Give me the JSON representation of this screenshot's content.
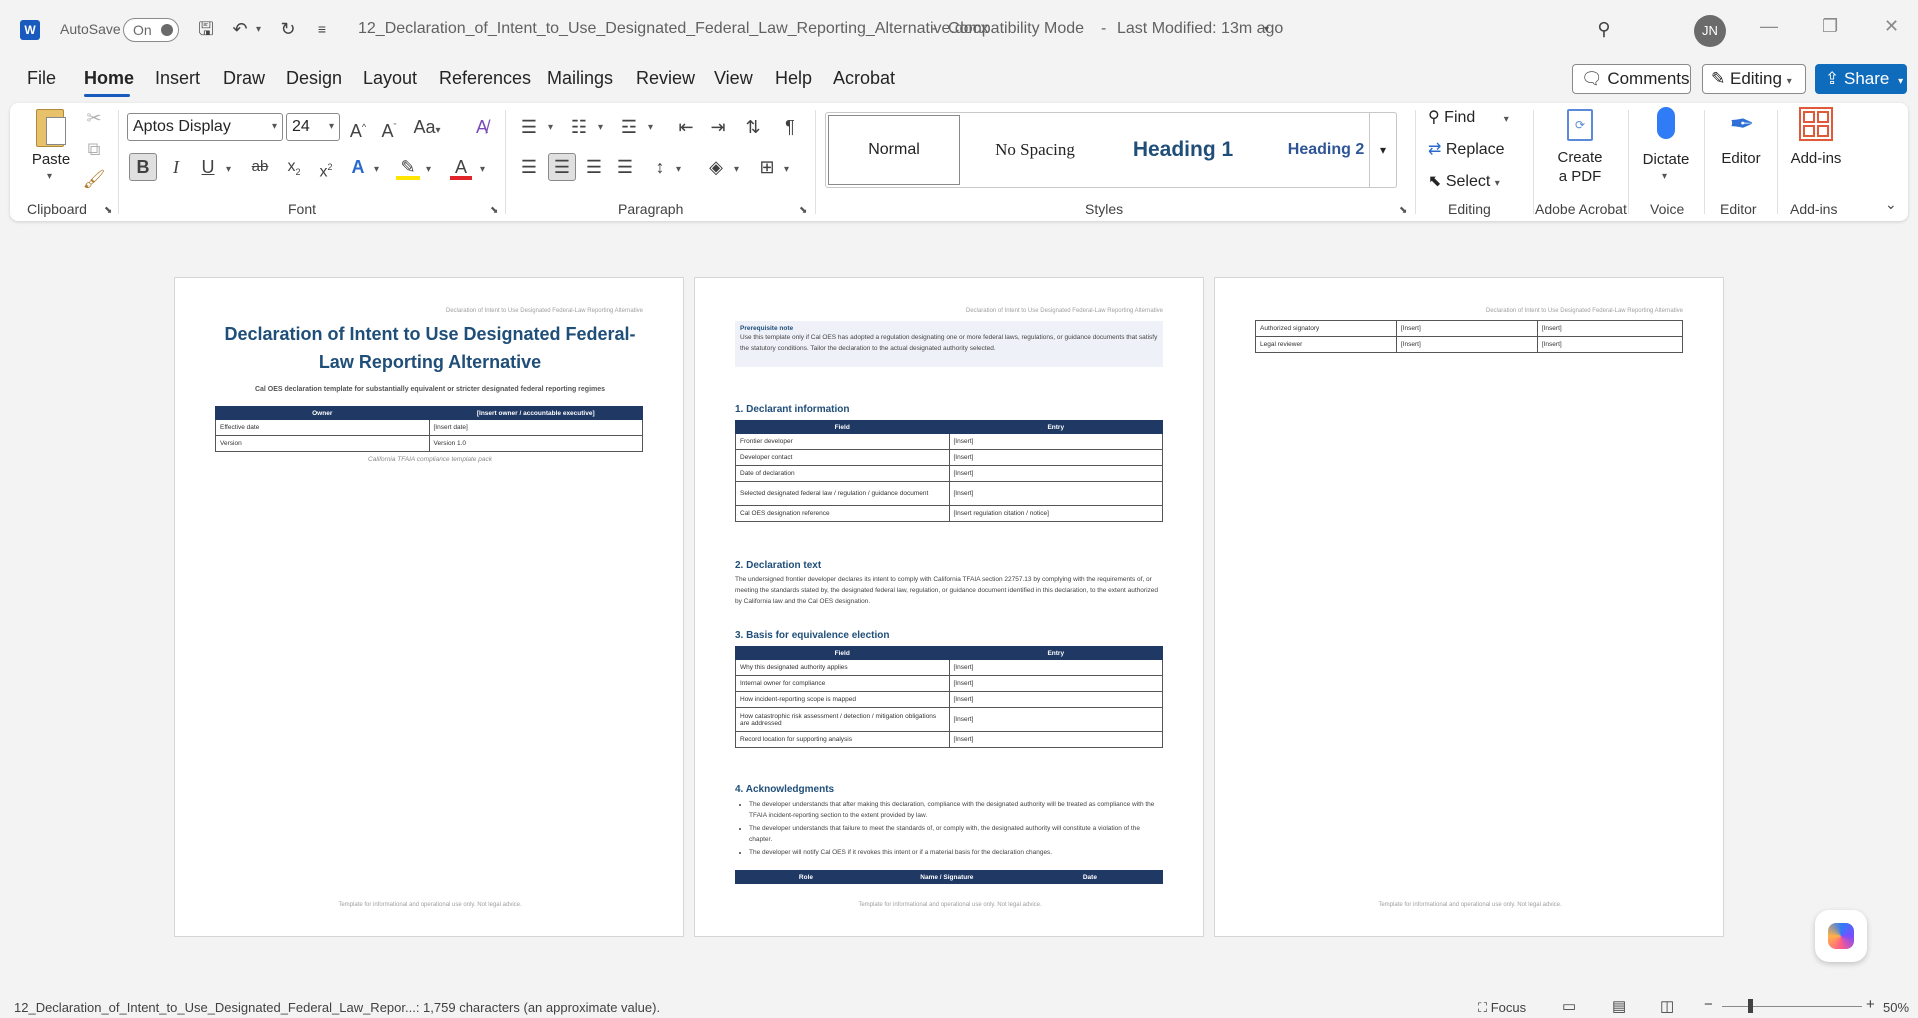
{
  "titlebar": {
    "autosave_label": "AutoSave",
    "autosave_state": "On",
    "document_title": "12_Declaration_of_Intent_to_Use_Designated_Federal_Law_Reporting_Alternative.docx",
    "separator": "-",
    "mode": "Compatibility Mode",
    "last_modified": "Last Modified: 13m ago",
    "avatar_initials": "JN"
  },
  "menu": {
    "tabs": [
      "File",
      "Home",
      "Insert",
      "Draw",
      "Design",
      "Layout",
      "References",
      "Mailings",
      "Review",
      "View",
      "Help",
      "Acrobat"
    ],
    "comments": "Comments",
    "editing": "Editing",
    "share": "Share"
  },
  "ribbon": {
    "clipboard": {
      "paste": "Paste",
      "label": "Clipboard"
    },
    "font": {
      "name": "Aptos Display",
      "size": "24",
      "label": "Font"
    },
    "paragraph": {
      "label": "Paragraph"
    },
    "styles": {
      "items": [
        "Normal",
        "No Spacing",
        "Heading 1",
        "Heading 2"
      ],
      "label": "Styles"
    },
    "editing": {
      "find": "Find",
      "replace": "Replace",
      "select": "Select",
      "label": "Editing"
    },
    "acrobat": {
      "create_pdf_1": "Create",
      "create_pdf_2": "a PDF",
      "label": "Adobe Acrobat"
    },
    "voice": {
      "dictate": "Dictate",
      "label": "Voice"
    },
    "editor": {
      "editor": "Editor",
      "label": "Editor"
    },
    "addins": {
      "addins": "Add-ins",
      "label": "Add-ins"
    }
  },
  "page1": {
    "header": "Declaration of Intent to Use Designated Federal-Law Reporting Alternative",
    "title_line1": "Declaration of Intent to Use Designated Federal-",
    "title_line2": "Law Reporting Alternative",
    "subtitle": "Cal OES declaration template for substantially equivalent or stricter designated federal reporting regimes",
    "table_headers": [
      "Owner",
      "[Insert owner / accountable executive]"
    ],
    "table_rows": [
      [
        "Effective date",
        "[Insert date]"
      ],
      [
        "Version",
        "Version 1.0"
      ]
    ],
    "caption": "California TFAIA compliance template pack",
    "footer": "Template for informational and operational use only. Not legal advice."
  },
  "page2": {
    "header": "Declaration of Intent to Use Designated Federal-Law Reporting Alternative",
    "note_title": "Prerequisite note",
    "note_text": "Use this template only if Cal OES has adopted a regulation designating one or more federal laws, regulations, or guidance documents that satisfy the statutory conditions. Tailor the declaration to the actual designated authority selected.",
    "s1_title": "1. Declarant information",
    "s1_headers": [
      "Field",
      "Entry"
    ],
    "s1_rows": [
      [
        "Frontier developer",
        "[Insert]"
      ],
      [
        "Developer contact",
        "[Insert]"
      ],
      [
        "Date of declaration",
        "[Insert]"
      ],
      [
        "Selected designated federal law / regulation / guidance document",
        "[Insert]"
      ],
      [
        "Cal OES designation reference",
        "[Insert regulation citation / notice]"
      ]
    ],
    "s2_title": "2. Declaration text",
    "s2_text": "The undersigned frontier developer declares its intent to comply with California TFAIA section 22757.13 by complying with the requirements of, or meeting the standards stated by, the designated federal law, regulation, or guidance document identified in this declaration, to the extent authorized by California law and the Cal OES designation.",
    "s3_title": "3. Basis for equivalence election",
    "s3_headers": [
      "Field",
      "Entry"
    ],
    "s3_rows": [
      [
        "Why this designated authority applies",
        "[Insert]"
      ],
      [
        "Internal owner for compliance",
        "[Insert]"
      ],
      [
        "How incident-reporting scope is mapped",
        "[Insert]"
      ],
      [
        "How catastrophic risk assessment / detection / mitigation obligations are addressed",
        "[Insert]"
      ],
      [
        "Record location for supporting analysis",
        "[Insert]"
      ]
    ],
    "s4_title": "4. Acknowledgments",
    "s4_bullets": [
      "The developer understands that after making this declaration, compliance with the designated authority will be treated as compliance with the TFAIA incident-reporting section to the extent provided by law.",
      "The developer understands that failure to meet the standards of, or comply with, the designated authority will constitute a violation of the chapter.",
      "The developer will notify Cal OES if it revokes this intent or if a material basis for the declaration changes."
    ],
    "sig_headers": [
      "Role",
      "Name / Signature",
      "Date"
    ],
    "footer": "Template for informational and operational use only. Not legal advice."
  },
  "page3": {
    "header": "Declaration of Intent to Use Designated Federal-Law Reporting Alternative",
    "rows": [
      [
        "Authorized signatory",
        "[Insert]",
        "[Insert]"
      ],
      [
        "Legal reviewer",
        "[Insert]",
        "[Insert]"
      ]
    ],
    "footer": "Template for informational and operational use only. Not legal advice."
  },
  "status": {
    "doc_info": "12_Declaration_of_Intent_to_Use_Designated_Federal_Law_Repor...: 1,759 characters (an approximate value).",
    "focus": "Focus",
    "zoom": "50%"
  }
}
